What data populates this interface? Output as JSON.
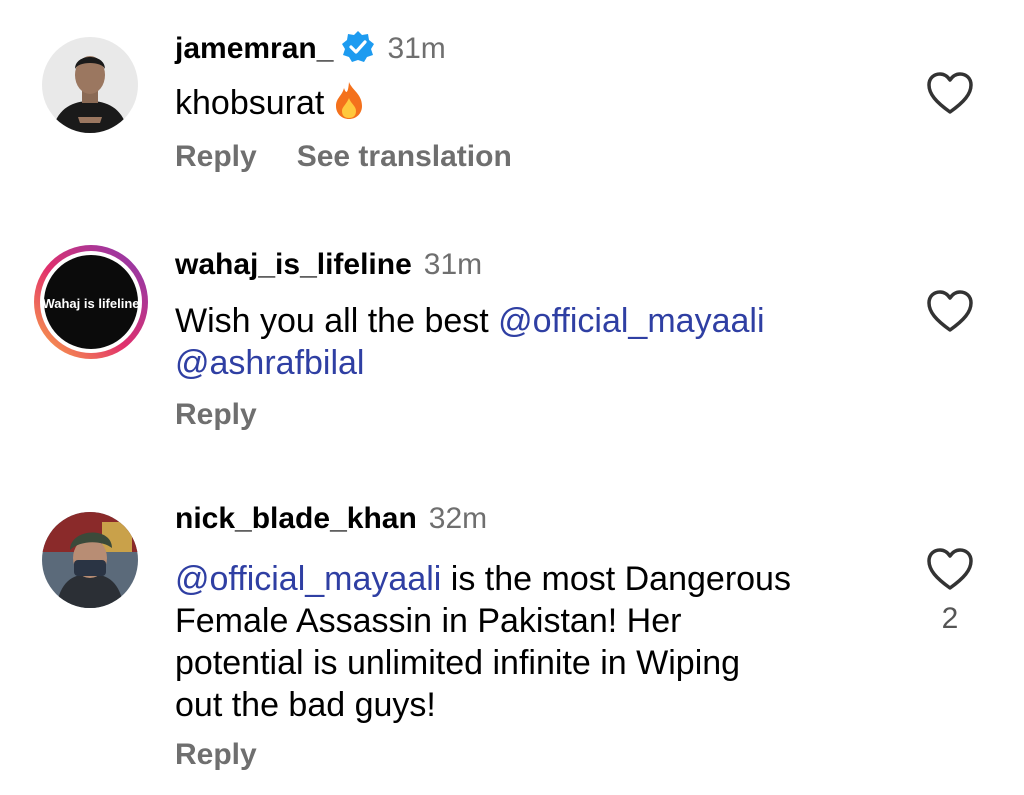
{
  "comments": [
    {
      "username": "jamemran_",
      "verified": true,
      "time": "31m",
      "text": "khobsurat",
      "emoji": "fire-emoji",
      "actions": {
        "reply": "Reply",
        "translate": "See translation"
      }
    },
    {
      "username": "wahaj_is_lifeline",
      "verified": false,
      "time": "31m",
      "avatar_text": "Wahaj is lifeline",
      "text_line1": "Wish you all the best ",
      "mention1": "@official_mayaali",
      "mention2": "@ashrafbilal",
      "actions": {
        "reply": "Reply"
      }
    },
    {
      "username": "nick_blade_khan",
      "verified": false,
      "time": "32m",
      "mention": "@official_mayaali",
      "line1_rest": " is the most Dangerous",
      "line2": "Female Assassin in Pakistan! Her",
      "line3": "potential is unlimited infinite in Wiping",
      "line4": "out the bad guys!",
      "like_count": "2",
      "actions": {
        "reply": "Reply"
      }
    }
  ],
  "colors": {
    "mention": "#2f3fa3",
    "secondary_text": "#6f6f6f",
    "verified_badge": "#1d9bf0"
  }
}
